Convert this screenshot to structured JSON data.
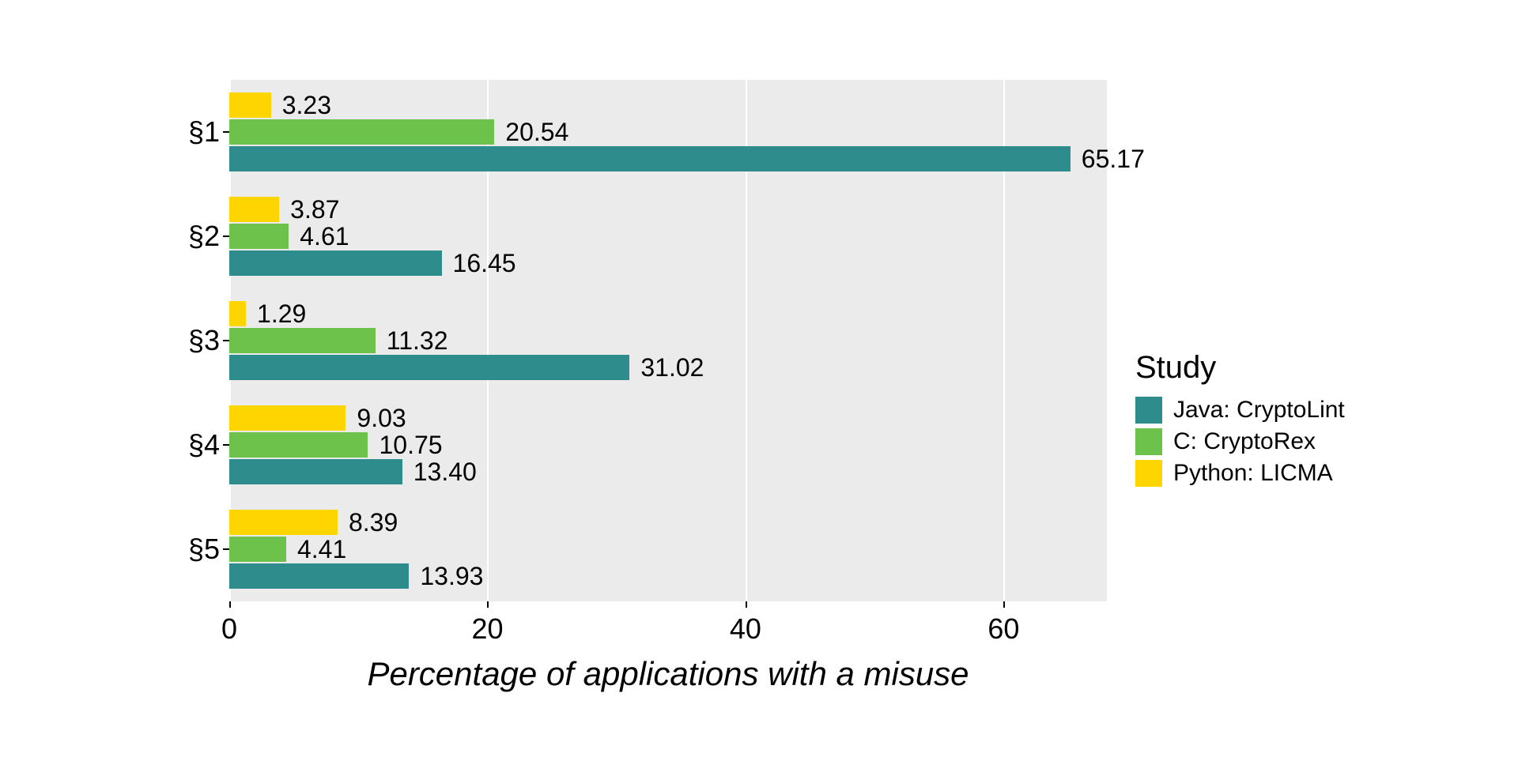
{
  "chart_data": {
    "type": "bar",
    "orientation": "horizontal",
    "categories": [
      "§1",
      "§2",
      "§3",
      "§4",
      "§5"
    ],
    "series": [
      {
        "name": "Java: CryptoLint",
        "color": "#2f8c8c",
        "values": [
          65.17,
          16.45,
          31.02,
          13.4,
          13.93
        ]
      },
      {
        "name": "C: CryptoRex",
        "color": "#6cc24a",
        "values": [
          20.54,
          4.61,
          11.32,
          10.75,
          4.41
        ]
      },
      {
        "name": "Python: LICMA",
        "color": "#ffd500",
        "values": [
          3.23,
          3.87,
          1.29,
          9.03,
          8.39
        ]
      }
    ],
    "xlabel": "Percentage of applications with a misuse",
    "ylabel": "",
    "xlim": [
      0,
      68
    ],
    "xticks": [
      0,
      20,
      40,
      60
    ],
    "legend_title": "Study"
  },
  "colors": {
    "java": "#2f8c8c",
    "c": "#6cc24a",
    "python": "#ffd500"
  },
  "labels": {
    "y": [
      "§1",
      "§2",
      "§3",
      "§4",
      "§5"
    ],
    "x_title": "Percentage of applications with a misuse",
    "legend_title": "Study",
    "legend_items": [
      "Java: CryptoLint",
      "C: CryptoRex",
      "Python: LICMA"
    ],
    "xticks": [
      "0",
      "20",
      "40",
      "60"
    ],
    "values": {
      "g1": {
        "python": "3.23",
        "c": "20.54",
        "java": "65.17"
      },
      "g2": {
        "python": "3.87",
        "c": "4.61",
        "java": "16.45"
      },
      "g3": {
        "python": "1.29",
        "c": "11.32",
        "java": "31.02"
      },
      "g4": {
        "python": "9.03",
        "c": "10.75",
        "java": "13.40"
      },
      "g5": {
        "python": "8.39",
        "c": "4.41",
        "java": "13.93"
      }
    }
  },
  "scale": {
    "xmax": 68
  }
}
